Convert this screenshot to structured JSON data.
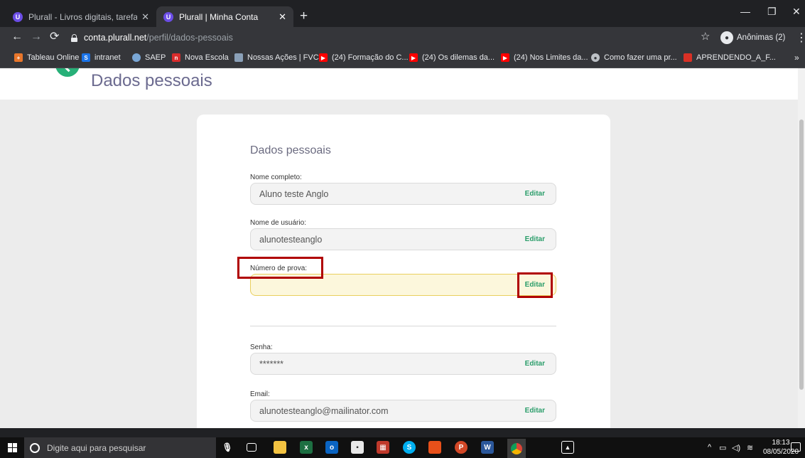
{
  "browser": {
    "tabs": [
      {
        "favicon": "U",
        "title": "Plurall - Livros digitais, tarefas, tu",
        "active": false
      },
      {
        "favicon": "U",
        "title": "Plurall | Minha Conta",
        "active": true
      }
    ],
    "new_tab": "+",
    "window_controls": {
      "minimize": "—",
      "restore": "❐",
      "close": "✕"
    },
    "nav": {
      "back": "←",
      "forward": "→",
      "reload": "⟳"
    },
    "url": {
      "host": "conta.plurall.net",
      "path": "/perfil/dados-pessoais"
    },
    "profile": {
      "label": "Anônimas (2)",
      "icon": "incognito-icon"
    },
    "bookmarks": [
      {
        "label": "Tableau Online",
        "icon": "tableau-icon",
        "color": "#e8762b"
      },
      {
        "label": "intranet",
        "icon": "intranet-icon",
        "color": "#1a73e8"
      },
      {
        "label": "SAEP",
        "icon": "saep-icon",
        "color": "#7aa7d6"
      },
      {
        "label": "Nova Escola",
        "icon": "nova-escola-icon",
        "color": "#d92c2c"
      },
      {
        "label": "Nossas Ações | FVC",
        "icon": "fvc-icon",
        "color": "#8aa0b8"
      },
      {
        "label": "(24) Formação do C...",
        "icon": "youtube-icon",
        "color": "#ff0000"
      },
      {
        "label": "(24) Os dilemas da...",
        "icon": "youtube-icon",
        "color": "#ff0000"
      },
      {
        "label": "(24) Nos Limites da...",
        "icon": "youtube-icon",
        "color": "#ff0000"
      },
      {
        "label": "Como fazer uma pr...",
        "icon": "globe-icon",
        "color": "#bdc1c6"
      },
      {
        "label": "APRENDENDO_A_F...",
        "icon": "calendar-icon",
        "color": "#d93025"
      }
    ],
    "bookmarks_more": "»"
  },
  "page": {
    "header_title": "Dados pessoais",
    "card_title": "Dados pessoais",
    "fields": [
      {
        "label": "Nome completo:",
        "value": "Aluno teste Anglo",
        "edit": "Editar"
      },
      {
        "label": "Nome de usuário:",
        "value": "alunotesteanglo",
        "edit": "Editar"
      },
      {
        "label": "Número de prova:",
        "value": "",
        "edit": "Editar"
      },
      {
        "label": "Senha:",
        "value": "*******",
        "edit": "Editar"
      },
      {
        "label": "Email:",
        "value": "alunotesteanglo@mailinator.com",
        "edit": "Editar"
      }
    ],
    "colors": {
      "accent_green": "#27b078",
      "annotation_red": "#b00000"
    }
  },
  "taskbar": {
    "search_placeholder": "Digite aqui para pesquisar",
    "apps": [
      "mic-icon",
      "task-view-icon",
      "file-explorer-icon",
      "excel-icon",
      "outlook-icon",
      "sticky-notes-icon",
      "calendar-app-icon",
      "skype-icon",
      "app-icon",
      "powerpoint-icon",
      "word-icon",
      "chrome-icon",
      "photos-icon"
    ],
    "time": "18:13",
    "date": "08/05/2020"
  }
}
